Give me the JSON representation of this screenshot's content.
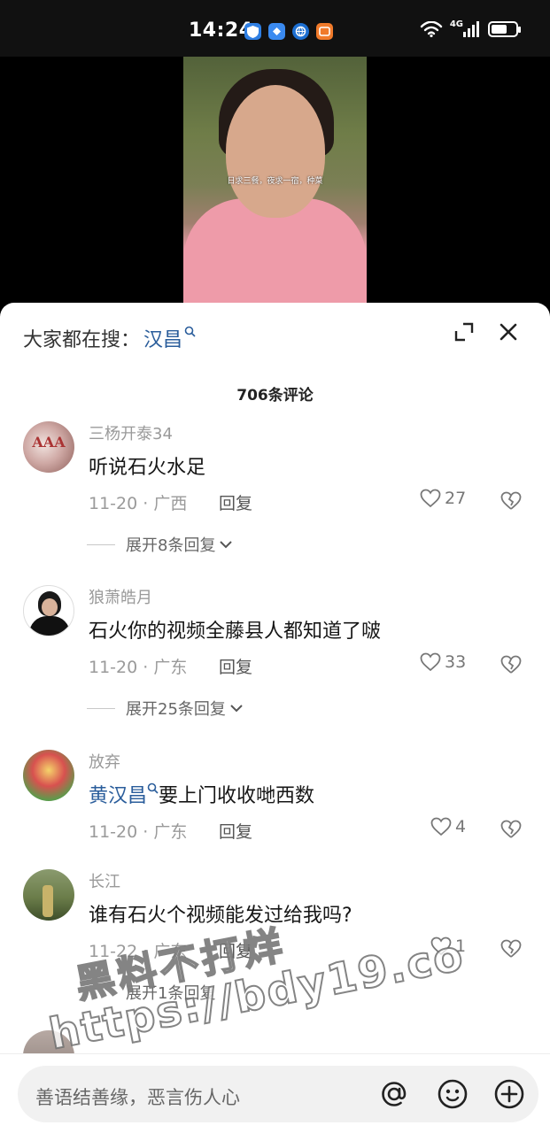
{
  "status_bar": {
    "time": "14:24",
    "network": "4G",
    "battery_level": 0.65,
    "app_icons": [
      "shield-app-icon",
      "blue-app-icon",
      "browser-app-icon",
      "orange-app-icon"
    ]
  },
  "video": {
    "caption": "日求三餐，夜求一宿，种菜"
  },
  "sheet": {
    "search_prefix": "大家都在搜：",
    "search_link": "汉昌",
    "comment_count": "706条评论"
  },
  "comments": [
    {
      "user": "三杨开泰34",
      "text": "听说石火水足",
      "date_loc": "11-20 · 广西",
      "reply": "回复",
      "likes": "27",
      "expand": "展开8条回复"
    },
    {
      "user": "狼萧皓月",
      "text": "石火你的视频全藤县人都知道了啵",
      "date_loc": "11-20 · 广东",
      "reply": "回复",
      "likes": "33",
      "expand": "展开25条回复"
    },
    {
      "user": "放弃",
      "link": "黄汉昌",
      "text": "要上门收收哋西数",
      "date_loc": "11-20 · 广东",
      "reply": "回复",
      "likes": "4"
    },
    {
      "user": "长江",
      "text": "谁有石火个视频能发过给我吗?",
      "date_loc": "11-22 · 广东",
      "reply": "回复",
      "likes": "1",
      "expand": "展开1条回复"
    }
  ],
  "watermark": {
    "line1": "黑料不打烊",
    "line2": "https://bdy19.co"
  },
  "input_bar": {
    "placeholder": "善语结善缘，恶言伤人心"
  },
  "colors": {
    "link": "#2a5d9b",
    "muted": "#9a9a9a",
    "text": "#161616"
  }
}
